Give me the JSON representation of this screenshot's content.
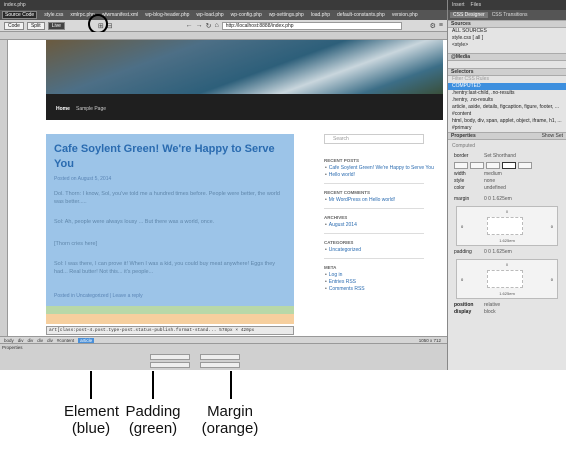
{
  "window": {
    "doc_tab": "index.php"
  },
  "file_tabs": [
    "Source Code",
    "style.css",
    "xmlrpc.php",
    "wlwmanifest.xml",
    "wp-blog-header.php",
    "wp-load.php",
    "wp-config.php",
    "wp-settings.php",
    "load.php",
    "default-constants.php",
    "version.php"
  ],
  "toolbar": {
    "code": "Code",
    "split": "Split",
    "live": "Live",
    "url": "http://localhost:8888/index.php"
  },
  "page": {
    "nav": {
      "home": "Home",
      "sample": "Sample Page"
    },
    "post": {
      "title": "Cafe Soylent Green! We're Happy to Serve You",
      "date": "Posted on August 5, 2014",
      "p1": "Dol. Thorn: I know, Sol, you've told me a hundred times before. People were better, the world was better.....",
      "p2": "Sol: Ah, people were always lousy ... But there was a world, once.",
      "p3": "[Thorn cries here]",
      "p4": "Sol: I was there, I can prove it! When I was a kid, you could buy meat anywhere! Eggs they had... Real butter! Not this... it's people...",
      "meta": "Posted in Uncategorized | Leave a reply"
    },
    "tagbar": "art[class:post-4.post.type-post.status-publish.format-stand... 578px × 420px",
    "sidebar": {
      "search_placeholder": "Search",
      "recent_posts_title": "RECENT POSTS",
      "recent_posts": [
        "Cafe Soylent Green! We're Happy to Serve You",
        "Hello world!"
      ],
      "recent_comments_title": "RECENT COMMENTS",
      "recent_comments": [
        "Mr WordPress on Hello world!"
      ],
      "archives_title": "ARCHIVES",
      "archives": [
        "August 2014"
      ],
      "categories_title": "CATEGORIES",
      "categories": [
        "Uncategorized"
      ],
      "meta_title": "META",
      "meta": [
        "Log in",
        "Entries RSS",
        "Comments RSS"
      ]
    }
  },
  "statusbar": {
    "tags": [
      "body",
      "div",
      "div",
      "div",
      "div",
      "#content",
      "article"
    ],
    "dims": "1050 x 712"
  },
  "properties": {
    "title": "Properties"
  },
  "right_panel": {
    "top_tabs": [
      "Insert",
      "Files"
    ],
    "sub_tabs": [
      "CSS Designer",
      "CSS Transitions"
    ],
    "sources_title": "Sources",
    "sources": [
      "ALL SOURCES",
      "style.css  [ all ]",
      "<style>"
    ],
    "media_title": "@Media",
    "selectors_title": "Selectors",
    "selectors_filter": "Filter CSS Rules",
    "selectors": [
      "COMPUTED",
      ".hentry:last-child, .no-results",
      ".hentry, .no-results",
      "article, aside, details, figcaption, figure, footer, ...",
      "#content",
      "html, body, div, span, applet, object, iframe, h1, ...",
      "#primary"
    ],
    "properties_title": "Properties",
    "show_set": "Show Set",
    "computed_label": "Computed",
    "border": {
      "label": "border",
      "value": "Set Shorthand"
    },
    "width": {
      "label": "width",
      "value": "medium"
    },
    "style": {
      "label": "style",
      "value": "none"
    },
    "color": {
      "label": "color",
      "value": "undefined"
    },
    "margin": {
      "label": "margin",
      "value": "0 0 1.625em",
      "top": "0",
      "bottom": "1.625em",
      "left": "0",
      "right": "0"
    },
    "padding": {
      "label": "padding",
      "value": "0 0 1.625em",
      "top": "0",
      "bottom": "1.625em",
      "left": "0",
      "right": "0"
    },
    "position": {
      "label": "position",
      "value": "relative"
    },
    "display": {
      "label": "display",
      "value": "block"
    }
  },
  "callouts": {
    "element": "Element\n(blue)",
    "padding": "Padding\n(green)",
    "margin": "Margin\n(orange)"
  },
  "colors": {
    "element": "#9cc4e8",
    "padding": "#b8d8a8",
    "margin": "#f6cf9e",
    "link": "#2a6bb0"
  }
}
